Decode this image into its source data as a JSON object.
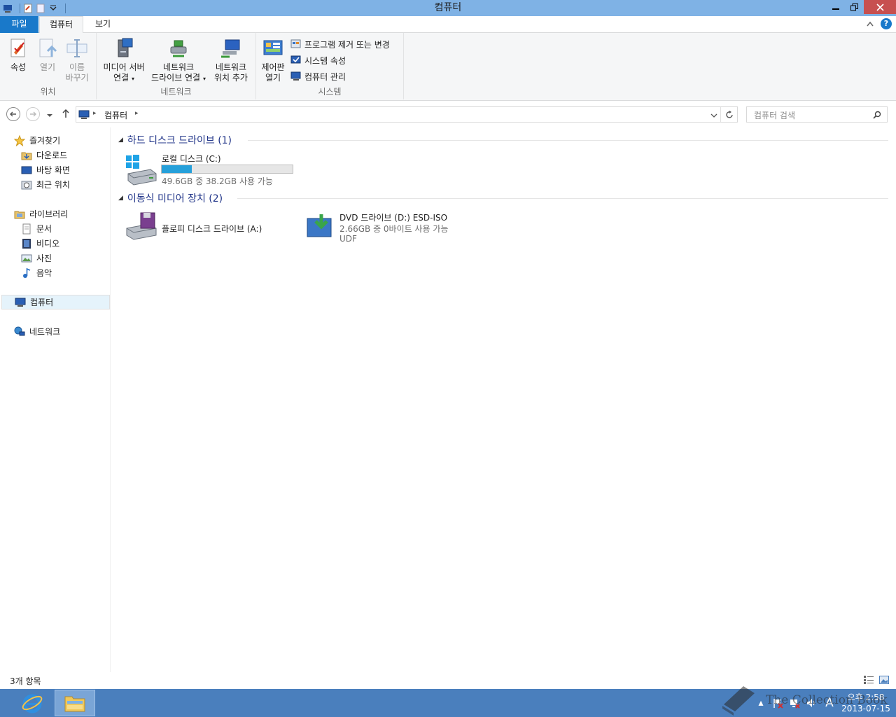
{
  "window": {
    "title": "컴퓨터"
  },
  "ribbon": {
    "tabs": [
      {
        "label": "파일"
      },
      {
        "label": "컴퓨터"
      },
      {
        "label": "보기"
      }
    ],
    "groups": {
      "location": {
        "label": "위치",
        "properties": "속성",
        "open": "열기",
        "rename_line1": "이름",
        "rename_line2": "바꾸기"
      },
      "network": {
        "label": "네트워크",
        "media_server_line1": "미디어 서버",
        "media_server_line2": "연결",
        "map_drive_line1": "네트워크",
        "map_drive_line2": "드라이브 연결",
        "add_location_line1": "네트워크",
        "add_location_line2": "위치 추가"
      },
      "system": {
        "label": "시스템",
        "control_panel_line1": "제어판",
        "control_panel_line2": "열기",
        "uninstall": "프로그램 제거 또는 변경",
        "system_properties": "시스템 속성",
        "manage": "컴퓨터 관리"
      }
    }
  },
  "address": {
    "crumb": "컴퓨터",
    "search_placeholder": "컴퓨터 검색"
  },
  "navpane": {
    "favorites": "즐겨찾기",
    "downloads": "다운로드",
    "desktop": "바탕 화면",
    "recent": "최근 위치",
    "libraries": "라이브러리",
    "documents": "문서",
    "videos": "비디오",
    "pictures": "사진",
    "music": "음악",
    "computer": "컴퓨터",
    "network": "네트워크"
  },
  "content": {
    "hdd_header": "하드 디스크 드라이브 (1)",
    "removable_header": "이동식 미디어 장치 (2)",
    "drive_c": {
      "name": "로컬 디스크 (C:)",
      "free": "49.6GB 중 38.2GB 사용 가능",
      "used_fraction": 0.23
    },
    "drive_a": {
      "name": "플로피 디스크 드라이브 (A:)"
    },
    "drive_d": {
      "name": "DVD 드라이브 (D:) ESD-ISO",
      "free": "2.66GB 중 0바이트 사용 가능",
      "fs": "UDF"
    }
  },
  "statusbar": {
    "count": "3개 항목"
  },
  "taskbar": {
    "time": "오후 2:58",
    "date": "2013-07-15",
    "ime": "A",
    "watermark": "The Collection Book"
  },
  "colors": {
    "title_bar": "#7fb2e5",
    "file_tab": "#1979ca",
    "taskbar": "#4a7fbd",
    "progress": "#26a0da"
  }
}
